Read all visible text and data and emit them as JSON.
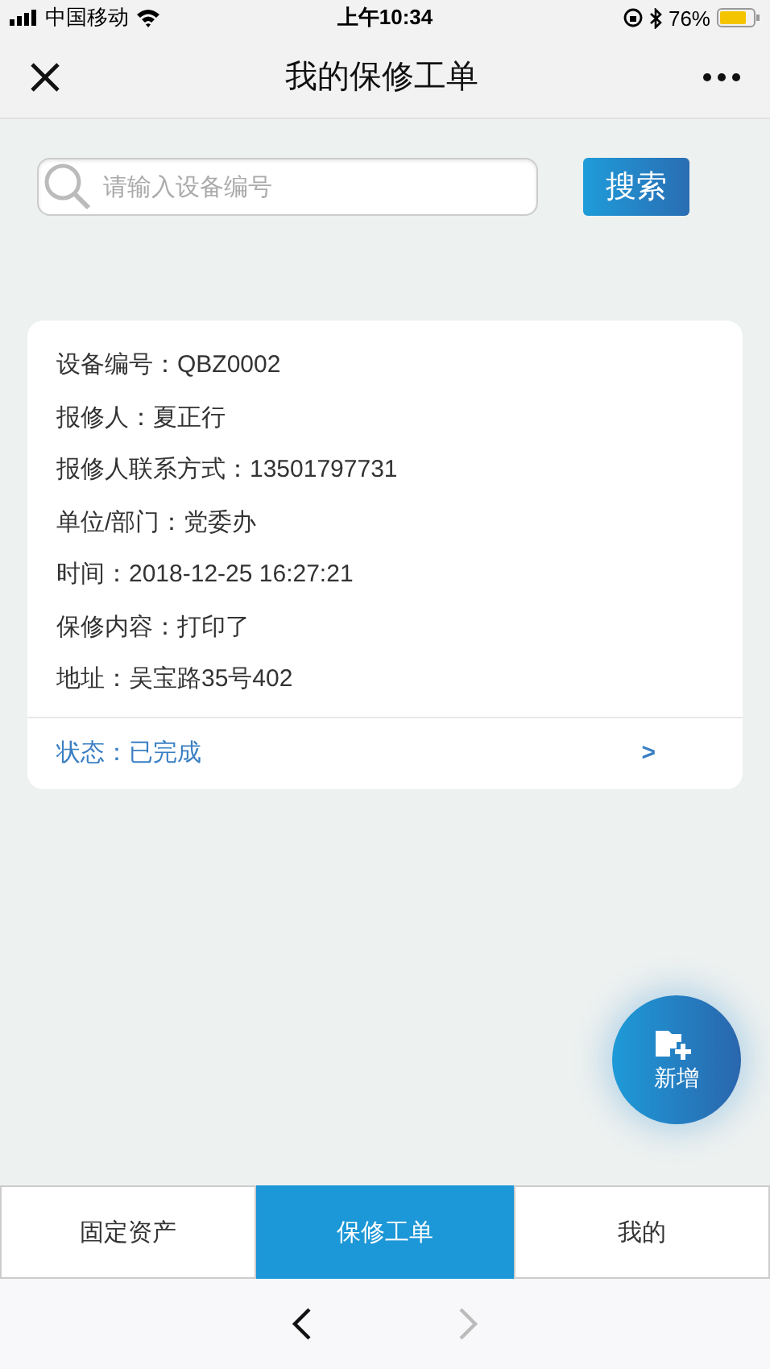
{
  "status_bar": {
    "carrier": "中国移动",
    "time": "上午10:34",
    "battery": "76%"
  },
  "nav": {
    "title": "我的保修工单"
  },
  "search": {
    "placeholder": "请输入设备编号",
    "button": "搜索"
  },
  "orders": [
    {
      "fields": [
        "设备编号：QBZ0002",
        "报修人：夏正行",
        "报修人联系方式：13501797731",
        "单位/部门：党委办",
        "时间：2018-12-25 16:27:21",
        "保修内容：打印了",
        "地址：吴宝路35号402"
      ],
      "status": "状态：已完成",
      "chevron": ">"
    }
  ],
  "fab": {
    "label": "新增"
  },
  "tabs": [
    {
      "label": "固定资产",
      "selected": false
    },
    {
      "label": "保修工单",
      "selected": true
    },
    {
      "label": "我的",
      "selected": false
    }
  ],
  "browser_nav": {
    "back_disabled": false,
    "forward_disabled": true
  }
}
